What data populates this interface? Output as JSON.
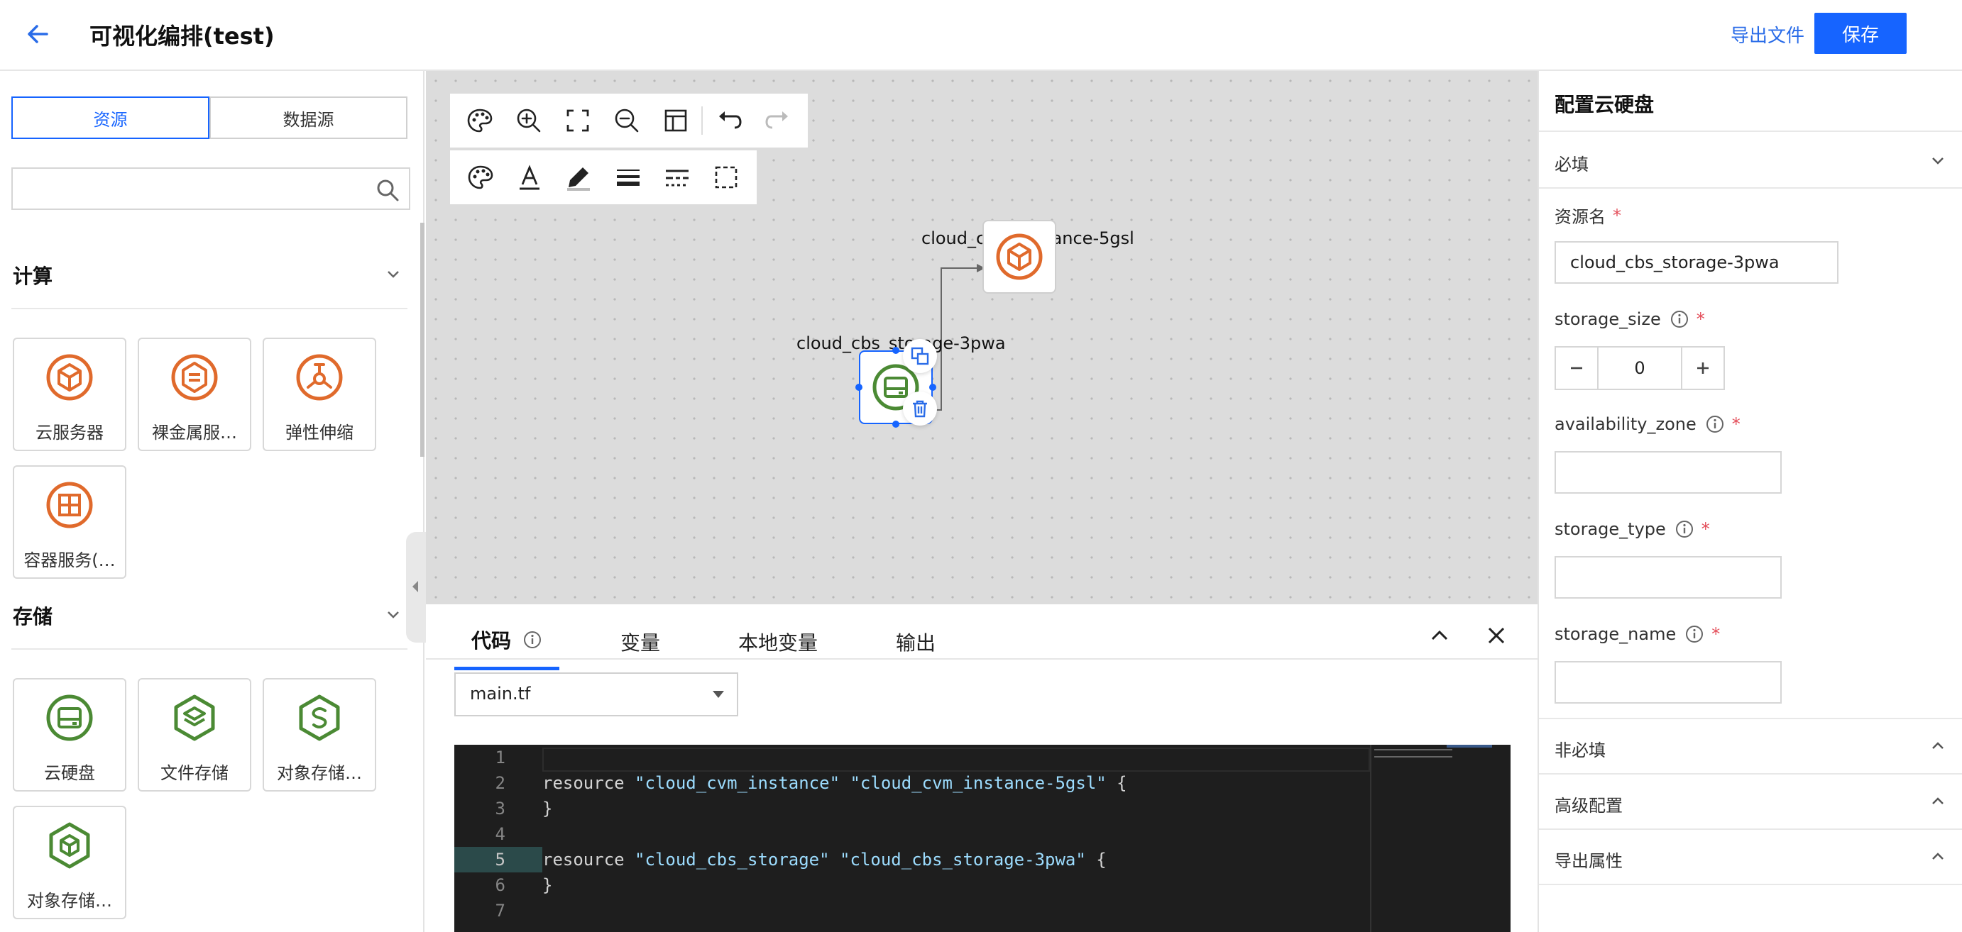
{
  "header": {
    "title": "可视化编排(test)",
    "export_label": "导出文件",
    "save_label": "保存"
  },
  "left_panel": {
    "tabs": [
      "资源",
      "数据源"
    ],
    "active_tab": "资源",
    "search": {
      "value": "",
      "placeholder": ""
    },
    "sections": [
      {
        "title": "计算",
        "items": [
          {
            "label": "云服务器",
            "icon": "cube-icon"
          },
          {
            "label": "裸金属服…",
            "icon": "bare-metal-icon"
          },
          {
            "label": "弹性伸缩",
            "icon": "scaling-icon"
          },
          {
            "label": "容器服务(…",
            "icon": "container-icon"
          }
        ]
      },
      {
        "title": "存储",
        "items": [
          {
            "label": "云硬盘",
            "icon": "disk-icon"
          },
          {
            "label": "文件存储",
            "icon": "file-storage-icon"
          },
          {
            "label": "对象存储…",
            "icon": "object-storage-icon"
          },
          {
            "label": "对象存储…",
            "icon": "object-storage-box-icon"
          }
        ]
      }
    ]
  },
  "canvas": {
    "nodes": [
      {
        "label": "cloud_cvm_instance-5gsl",
        "icon": "cube-icon",
        "selected": false
      },
      {
        "label": "cloud_cbs_storage-3pwa",
        "icon": "disk-icon",
        "selected": true
      }
    ]
  },
  "bottom_panel": {
    "tabs": [
      "代码",
      "变量",
      "本地变量",
      "输出"
    ],
    "active_tab": "代码",
    "file": "main.tf",
    "code_lines": [
      {
        "num": "1",
        "code": ""
      },
      {
        "num": "2",
        "code": "resource \"cloud_cvm_instance\" \"cloud_cvm_instance-5gsl\" {"
      },
      {
        "num": "3",
        "code": "}"
      },
      {
        "num": "4",
        "code": ""
      },
      {
        "num": "5",
        "code": "resource \"cloud_cbs_storage\" \"cloud_cbs_storage-3pwa\" {"
      },
      {
        "num": "6",
        "code": "}"
      },
      {
        "num": "7",
        "code": ""
      }
    ]
  },
  "right_panel": {
    "title": "配置云硬盘",
    "required_section": "必填",
    "fields": {
      "resource_name_label": "资源名",
      "resource_name_value": "cloud_cbs_storage-3pwa",
      "storage_size_label": "storage_size",
      "storage_size_value": "0",
      "availability_zone_label": "availability_zone",
      "availability_zone_value": "",
      "storage_type_label": "storage_type",
      "storage_type_value": "",
      "storage_name_label": "storage_name",
      "storage_name_value": ""
    },
    "required_mark": "*",
    "collapsed_sections": [
      "非必填",
      "高级配置",
      "导出属性"
    ]
  },
  "colors": {
    "primary": "#1664ff",
    "compute_orange": "#e06a2c",
    "storage_green": "#4b8a34"
  }
}
